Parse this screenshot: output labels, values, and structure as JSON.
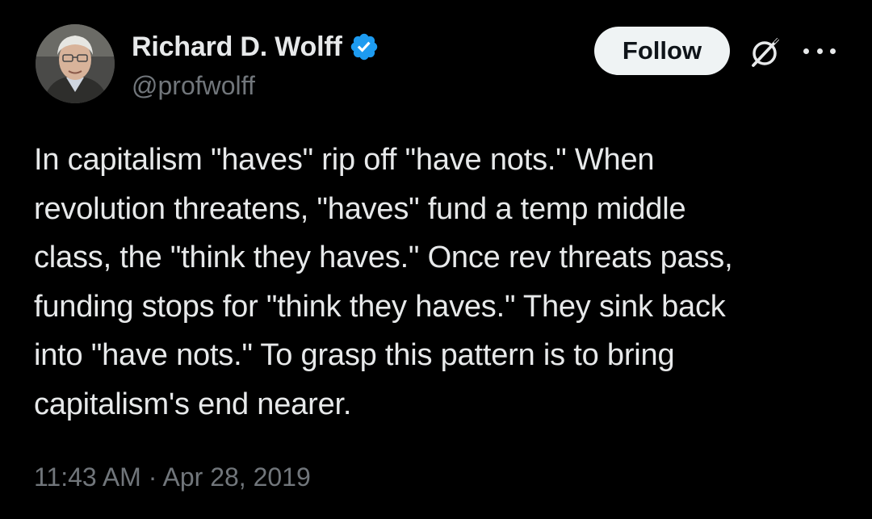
{
  "author": {
    "display_name": "Richard D. Wolff",
    "handle": "@profwolff",
    "verified": true
  },
  "actions": {
    "follow_label": "Follow"
  },
  "tweet": {
    "lines": [
      "In capitalism \"haves\" rip off \"have nots.\" When",
      "revolution threatens, \"haves\" fund a temp middle",
      "class, the \"think they haves.\" Once rev threats pass,",
      "funding stops for \"think they haves.\" They sink back",
      "into \"have nots.\" To grasp this pattern is to bring",
      "capitalism's end nearer."
    ],
    "timestamp": "11:43 AM · Apr 28, 2019"
  },
  "colors": {
    "background": "#000000",
    "text": "#e7e9ea",
    "secondary_text": "#71767b",
    "verified_badge": "#1d9bf0",
    "follow_button_bg": "#eff3f4"
  },
  "icons": {
    "verified": "verified-badge-icon",
    "grok": "grok-icon",
    "more": "more-options-icon"
  }
}
